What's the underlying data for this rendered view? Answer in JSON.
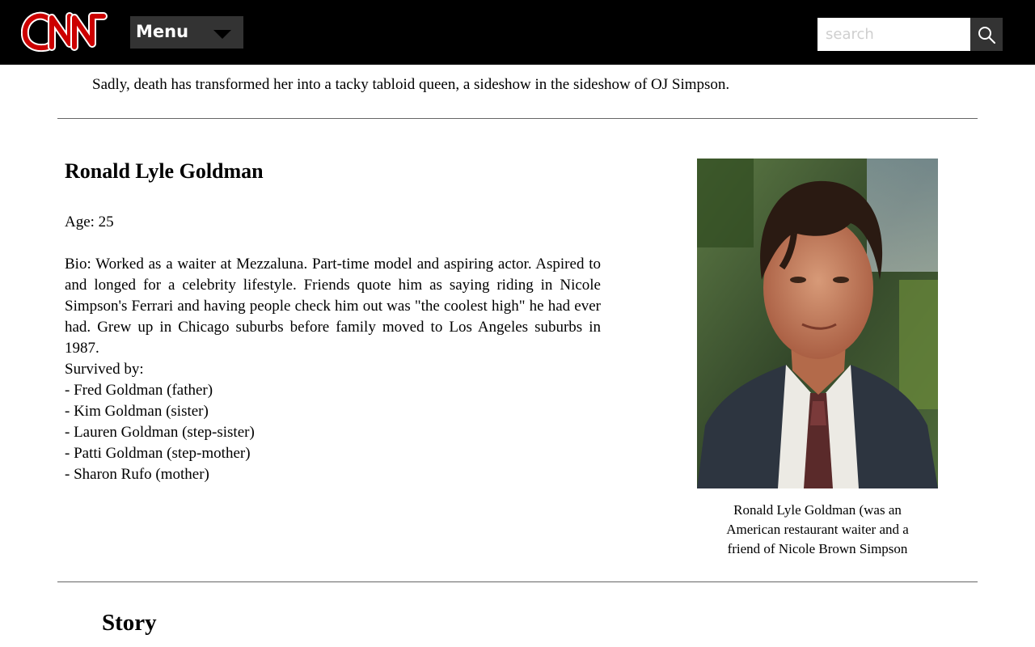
{
  "header": {
    "logo_text": "CNN",
    "menu_label": "Menu",
    "search": {
      "placeholder": "search",
      "value": ""
    }
  },
  "intro_text": "Sadly, death has transformed her into a tacky tabloid queen, a sideshow in the sideshow of OJ Simpson.",
  "profile": {
    "name": "Ronald Lyle Goldman",
    "age": "Age: 25",
    "bio": "Bio: Worked as a waiter at Mezzaluna. Part-time model and aspiring actor. Aspired to and longed for a celebrity lifestyle. Friends quote him as saying riding in Nicole Simpson's Ferrari and having people check him out was \"the coolest high\" he had ever had. Grew up in Chicago suburbs before family moved to Los Angeles suburbs in 1987.",
    "survived_by_label": "Survived by:",
    "survived_by": [
      "- Fred Goldman (father)",
      "- Kim Goldman (sister)",
      "- Lauren Goldman (step-sister)",
      "- Patti Goldman (step-mother)",
      "- Sharon Rufo (mother)"
    ],
    "photo_caption": "Ronald Lyle Goldman (was an American restaurant waiter and a friend of Nicole Brown Simpson"
  },
  "story_heading": "Story",
  "colors": {
    "header_bg": "#000000",
    "logo_red": "#cc0000",
    "menu_bg": "#333333"
  }
}
